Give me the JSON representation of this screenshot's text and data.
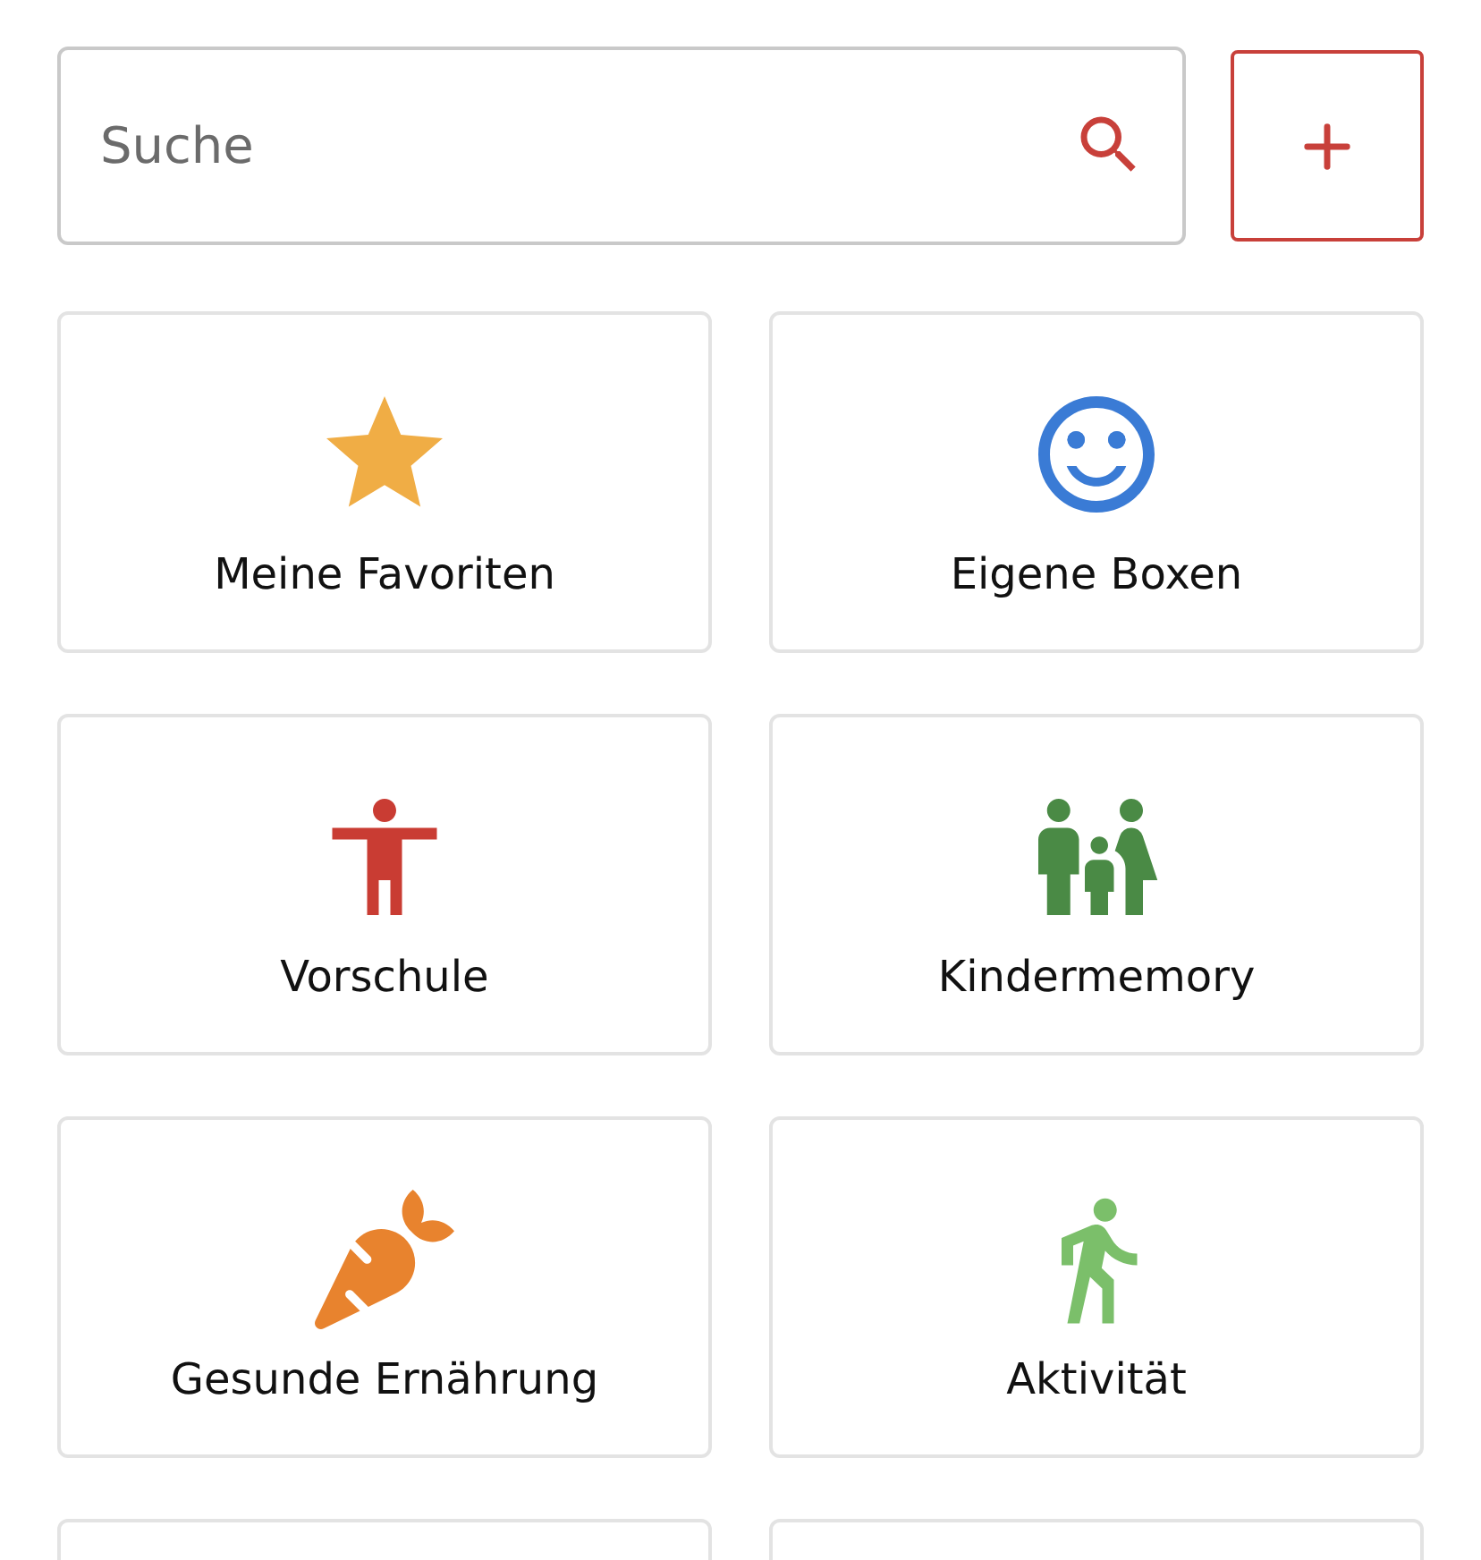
{
  "search": {
    "placeholder": "Suche"
  },
  "cards": [
    {
      "kind": "star",
      "label": "Meine Favoriten"
    },
    {
      "kind": "smiley",
      "label": "Eigene Boxen"
    },
    {
      "kind": "person",
      "label": "Vorschule"
    },
    {
      "kind": "family",
      "label": "Kindermemory"
    },
    {
      "kind": "carrot",
      "label": "Gesunde Ernährung"
    },
    {
      "kind": "walker",
      "label": "Aktivität"
    },
    {
      "kind": "blank"
    },
    {
      "kind": "blank"
    }
  ]
}
